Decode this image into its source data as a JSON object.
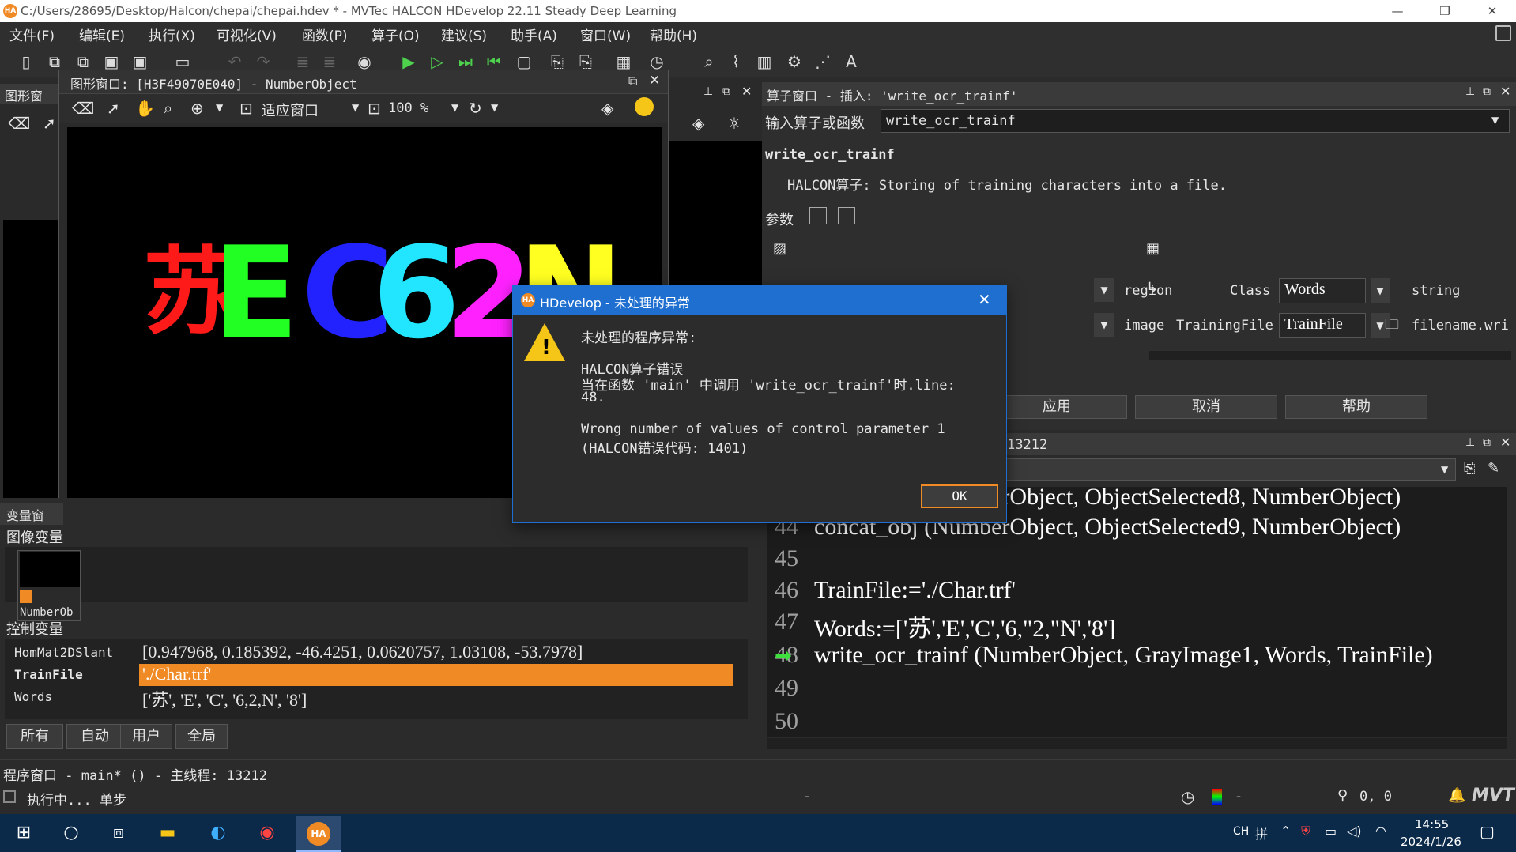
{
  "window": {
    "title": "C:/Users/28695/Desktop/Halcon/chepai/chepai.hdev * - MVTec HALCON HDevelop 22.11 Steady Deep Learning",
    "logo": "HA",
    "min": "—",
    "max": "❐",
    "close": "✕"
  },
  "menu": [
    "文件(F)",
    "编辑(E)",
    "执行(X)",
    "可视化(V)",
    "函数(P)",
    "算子(O)",
    "建议(S)",
    "助手(A)",
    "窗口(W)",
    "帮助(H)"
  ],
  "toolbar": {
    "zoom_text": "适应窗口",
    "zoom_percent": "100 %"
  },
  "left_panel": {
    "title": "图形窗"
  },
  "graphics_window": {
    "title": "图形窗口: [H3F49070E040] - NumberObject",
    "plate_chars": [
      {
        "ch": "苏",
        "color": "#ff1a1a"
      },
      {
        "ch": "E",
        "color": "#22ff22"
      },
      {
        "ch": "C",
        "color": "#2222ff"
      },
      {
        "ch": "6",
        "color": "#22e5ff"
      },
      {
        "ch": "2",
        "color": "#ff22ff"
      },
      {
        "ch": "N",
        "color": "#ffff22"
      }
    ]
  },
  "operator_window": {
    "title": "算子窗口 - 插入: 'write_ocr_trainf'",
    "input_label": "输入算子或函数",
    "input_value": "write_ocr_trainf",
    "op_name": "write_ocr_trainf",
    "op_desc": "HALCON算子: Storing of training characters into a file.",
    "params_label": "参数",
    "params_left": [
      {
        "type": "region"
      },
      {
        "type": "image"
      }
    ],
    "params_right": [
      {
        "name": "Class",
        "value": "Words",
        "type": "string"
      },
      {
        "name": "TrainingFile",
        "value": "TrainFile",
        "type": "filename.wri"
      }
    ],
    "buttons": [
      "应用",
      "取消",
      "帮助"
    ]
  },
  "variable_window": {
    "title": "变量窗",
    "image_vars_label": "图像变量",
    "image_var_name": "NumberOb",
    "control_vars_label": "控制变量",
    "control_vars": [
      {
        "name": "HomMat2DSlant",
        "value": "[0.947968, 0.185392, -46.4251, 0.0620757, 1.03108, -53.7978]",
        "selected": false
      },
      {
        "name": "TrainFile",
        "value": "'./Char.trf'",
        "selected": true
      },
      {
        "name": "Words",
        "value": "['苏', 'E', 'C', '6,2,N', '8']",
        "selected": false
      }
    ],
    "tabs": [
      "所有",
      "自动",
      "用户",
      "全局"
    ]
  },
  "program_window": {
    "thread_text": "13212",
    "lines": [
      {
        "n": "43",
        "code": "concat_obj (NumberObject, ObjectSelected8, NumberObject)"
      },
      {
        "n": "44",
        "code": "concat_obj (NumberObject, ObjectSelected9, NumberObject)"
      },
      {
        "n": "45",
        "code": ""
      },
      {
        "n": "46",
        "code": "TrainFile:='./Char.trf'"
      },
      {
        "n": "47",
        "code": "Words:=['苏','E','C','6,\"2,\"N','8']"
      },
      {
        "n": "48",
        "code": "write_ocr_trainf (NumberObject, GrayImage1, Words, TrainFile)"
      },
      {
        "n": "49",
        "code": ""
      },
      {
        "n": "50",
        "code": ""
      }
    ]
  },
  "status": {
    "program": "程序窗口 - main* () - 主线程: 13212",
    "run_state": "执行中... 单步",
    "dash": "-",
    "coords": "0, 0",
    "brand": "MVT"
  },
  "taskbar": {
    "lang": "CH",
    "ime": "拼",
    "time": "14:55",
    "date": "2024/1/26"
  },
  "dialog": {
    "title": "HDevelop - 未处理的异常",
    "heading": "未处理的程序异常:",
    "line1": "HALCON算子错误",
    "line2": "当在函数 'main' 中调用 'write_ocr_trainf'时.line:",
    "line3": "48.",
    "line4": "Wrong number of values of control parameter 1",
    "line5": "(HALCON错误代码: 1401)",
    "ok": "OK"
  }
}
